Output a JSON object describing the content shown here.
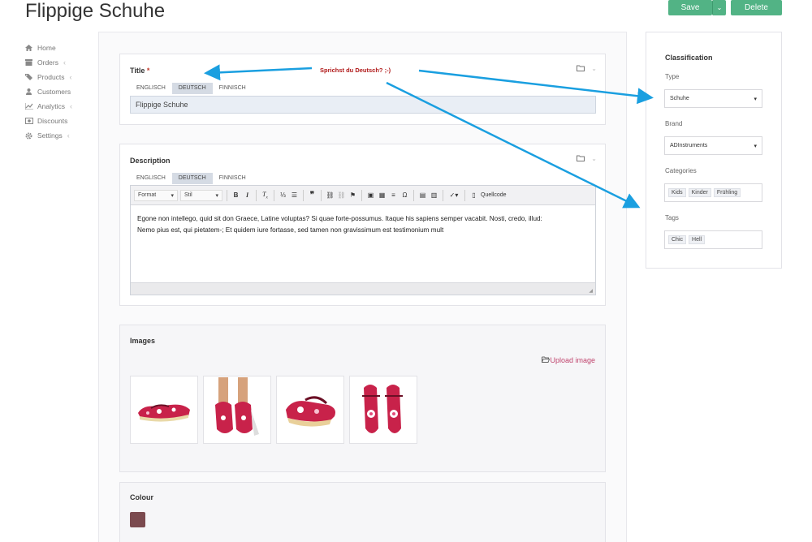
{
  "page": {
    "title": "Flippige Schuhe"
  },
  "header": {
    "save_label": "Save",
    "dropdown_glyph": "⌄",
    "delete_label": "Delete"
  },
  "sidebar": {
    "items": [
      {
        "label": "Home",
        "icon": "home-icon",
        "has_chevron": false
      },
      {
        "label": "Orders",
        "icon": "orders-icon",
        "has_chevron": true
      },
      {
        "label": "Products",
        "icon": "tag-icon",
        "has_chevron": true
      },
      {
        "label": "Customers",
        "icon": "user-icon",
        "has_chevron": false
      },
      {
        "label": "Analytics",
        "icon": "chart-icon",
        "has_chevron": true
      },
      {
        "label": "Discounts",
        "icon": "money-icon",
        "has_chevron": false
      },
      {
        "label": "Settings",
        "icon": "gear-icon",
        "has_chevron": true
      }
    ]
  },
  "title_card": {
    "label": "Title",
    "required_marker": "*",
    "tabs": [
      "ENGLISCH",
      "DEUTSCH",
      "FINNISCH"
    ],
    "active_tab": "DEUTSCH",
    "value": "Flippige Schuhe"
  },
  "description_card": {
    "label": "Description",
    "tabs": [
      "ENGLISCH",
      "DEUTSCH",
      "FINNISCH"
    ],
    "active_tab": "DEUTSCH",
    "toolbar": {
      "format_label": "Format",
      "style_label": "Stil",
      "source_label": "Quellcode"
    },
    "text_line1": "Egone non intellego, quid sit don Graece, Latine voluptas? Si quae forte-possumus. Itaque his sapiens semper vacabit. Nosti, credo, illud:",
    "text_line2": "Nemo pius est, qui pietatem-; Et quidem iure fortasse, sed tamen non gravissimum est testimonium mult"
  },
  "images_card": {
    "label": "Images",
    "upload_label": "Upload image",
    "images": [
      "shoe-image-1",
      "shoe-image-2",
      "shoe-image-3",
      "shoe-image-4"
    ]
  },
  "colour_card": {
    "label": "Colour",
    "swatch_color": "#7b4a4f"
  },
  "classification": {
    "title": "Classification",
    "type_label": "Type",
    "type_value": "Schuhe",
    "brand_label": "Brand",
    "brand_value": "ADInstruments",
    "categories_label": "Categories",
    "categories": [
      "Kids",
      "Kinder",
      "Frühling"
    ],
    "tags_label": "Tags",
    "tags": [
      "Chic",
      "Hell"
    ]
  },
  "annotation": {
    "text": "Sprichst du Deutsch? ;-)",
    "arrow_color": "#1a9fe0"
  },
  "colors": {
    "accent_green": "#52b385",
    "link_pink": "#c0456e",
    "annotation_red": "#b01818"
  }
}
